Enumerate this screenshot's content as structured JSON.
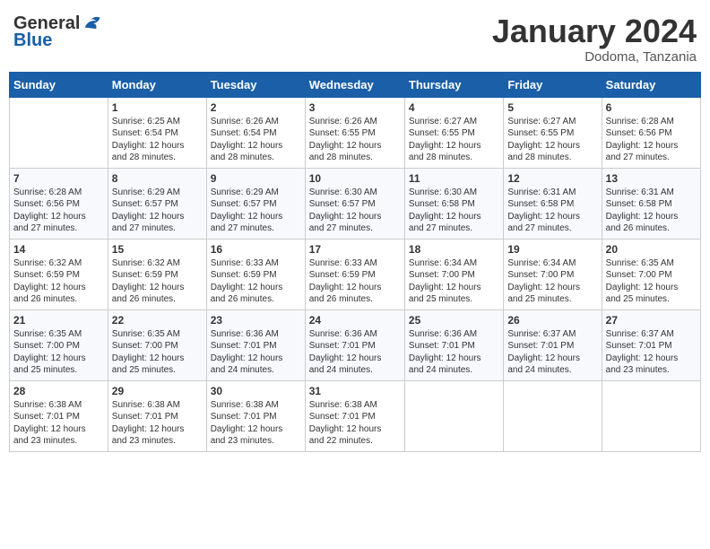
{
  "header": {
    "logo_general": "General",
    "logo_blue": "Blue",
    "month": "January 2024",
    "location": "Dodoma, Tanzania"
  },
  "days_of_week": [
    "Sunday",
    "Monday",
    "Tuesday",
    "Wednesday",
    "Thursday",
    "Friday",
    "Saturday"
  ],
  "weeks": [
    [
      {
        "day": "",
        "info": ""
      },
      {
        "day": "1",
        "info": "Sunrise: 6:25 AM\nSunset: 6:54 PM\nDaylight: 12 hours\nand 28 minutes."
      },
      {
        "day": "2",
        "info": "Sunrise: 6:26 AM\nSunset: 6:54 PM\nDaylight: 12 hours\nand 28 minutes."
      },
      {
        "day": "3",
        "info": "Sunrise: 6:26 AM\nSunset: 6:55 PM\nDaylight: 12 hours\nand 28 minutes."
      },
      {
        "day": "4",
        "info": "Sunrise: 6:27 AM\nSunset: 6:55 PM\nDaylight: 12 hours\nand 28 minutes."
      },
      {
        "day": "5",
        "info": "Sunrise: 6:27 AM\nSunset: 6:55 PM\nDaylight: 12 hours\nand 28 minutes."
      },
      {
        "day": "6",
        "info": "Sunrise: 6:28 AM\nSunset: 6:56 PM\nDaylight: 12 hours\nand 27 minutes."
      }
    ],
    [
      {
        "day": "7",
        "info": "Sunrise: 6:28 AM\nSunset: 6:56 PM\nDaylight: 12 hours\nand 27 minutes."
      },
      {
        "day": "8",
        "info": "Sunrise: 6:29 AM\nSunset: 6:57 PM\nDaylight: 12 hours\nand 27 minutes."
      },
      {
        "day": "9",
        "info": "Sunrise: 6:29 AM\nSunset: 6:57 PM\nDaylight: 12 hours\nand 27 minutes."
      },
      {
        "day": "10",
        "info": "Sunrise: 6:30 AM\nSunset: 6:57 PM\nDaylight: 12 hours\nand 27 minutes."
      },
      {
        "day": "11",
        "info": "Sunrise: 6:30 AM\nSunset: 6:58 PM\nDaylight: 12 hours\nand 27 minutes."
      },
      {
        "day": "12",
        "info": "Sunrise: 6:31 AM\nSunset: 6:58 PM\nDaylight: 12 hours\nand 27 minutes."
      },
      {
        "day": "13",
        "info": "Sunrise: 6:31 AM\nSunset: 6:58 PM\nDaylight: 12 hours\nand 26 minutes."
      }
    ],
    [
      {
        "day": "14",
        "info": "Sunrise: 6:32 AM\nSunset: 6:59 PM\nDaylight: 12 hours\nand 26 minutes."
      },
      {
        "day": "15",
        "info": "Sunrise: 6:32 AM\nSunset: 6:59 PM\nDaylight: 12 hours\nand 26 minutes."
      },
      {
        "day": "16",
        "info": "Sunrise: 6:33 AM\nSunset: 6:59 PM\nDaylight: 12 hours\nand 26 minutes."
      },
      {
        "day": "17",
        "info": "Sunrise: 6:33 AM\nSunset: 6:59 PM\nDaylight: 12 hours\nand 26 minutes."
      },
      {
        "day": "18",
        "info": "Sunrise: 6:34 AM\nSunset: 7:00 PM\nDaylight: 12 hours\nand 25 minutes."
      },
      {
        "day": "19",
        "info": "Sunrise: 6:34 AM\nSunset: 7:00 PM\nDaylight: 12 hours\nand 25 minutes."
      },
      {
        "day": "20",
        "info": "Sunrise: 6:35 AM\nSunset: 7:00 PM\nDaylight: 12 hours\nand 25 minutes."
      }
    ],
    [
      {
        "day": "21",
        "info": "Sunrise: 6:35 AM\nSunset: 7:00 PM\nDaylight: 12 hours\nand 25 minutes."
      },
      {
        "day": "22",
        "info": "Sunrise: 6:35 AM\nSunset: 7:00 PM\nDaylight: 12 hours\nand 25 minutes."
      },
      {
        "day": "23",
        "info": "Sunrise: 6:36 AM\nSunset: 7:01 PM\nDaylight: 12 hours\nand 24 minutes."
      },
      {
        "day": "24",
        "info": "Sunrise: 6:36 AM\nSunset: 7:01 PM\nDaylight: 12 hours\nand 24 minutes."
      },
      {
        "day": "25",
        "info": "Sunrise: 6:36 AM\nSunset: 7:01 PM\nDaylight: 12 hours\nand 24 minutes."
      },
      {
        "day": "26",
        "info": "Sunrise: 6:37 AM\nSunset: 7:01 PM\nDaylight: 12 hours\nand 24 minutes."
      },
      {
        "day": "27",
        "info": "Sunrise: 6:37 AM\nSunset: 7:01 PM\nDaylight: 12 hours\nand 23 minutes."
      }
    ],
    [
      {
        "day": "28",
        "info": "Sunrise: 6:38 AM\nSunset: 7:01 PM\nDaylight: 12 hours\nand 23 minutes."
      },
      {
        "day": "29",
        "info": "Sunrise: 6:38 AM\nSunset: 7:01 PM\nDaylight: 12 hours\nand 23 minutes."
      },
      {
        "day": "30",
        "info": "Sunrise: 6:38 AM\nSunset: 7:01 PM\nDaylight: 12 hours\nand 23 minutes."
      },
      {
        "day": "31",
        "info": "Sunrise: 6:38 AM\nSunset: 7:01 PM\nDaylight: 12 hours\nand 22 minutes."
      },
      {
        "day": "",
        "info": ""
      },
      {
        "day": "",
        "info": ""
      },
      {
        "day": "",
        "info": ""
      }
    ]
  ]
}
